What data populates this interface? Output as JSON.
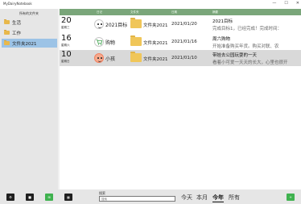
{
  "window": {
    "title": "MyDairyNotebook",
    "controls": [
      "—",
      "☐",
      "✕"
    ]
  },
  "sidebar": {
    "title": "所有的文件夹",
    "items": [
      {
        "label": "生活"
      },
      {
        "label": "工作"
      },
      {
        "label": "文件夹2021",
        "selected": true
      }
    ]
  },
  "table": {
    "headers": {
      "day": "",
      "diary": "日记",
      "folder": "文件夹",
      "date": "日期",
      "content": "摘要"
    },
    "rows": [
      {
        "day": "20",
        "weekday": "星期三",
        "avatar": "smiley-icon",
        "name": "2021目标",
        "folder": "文件夹2021",
        "date": "2021/01/20",
        "title": "2021目标",
        "preview": "完成目标1，已经完成！完成时间："
      },
      {
        "day": "16",
        "weekday": "星期六",
        "avatar": "cart-icon",
        "name": "购物",
        "folder": "文件夹2021",
        "date": "2021/01/16",
        "title": "周六购物",
        "preview": "开始准备购买年货。购买对联、农"
      },
      {
        "day": "10",
        "weekday": "星期日",
        "avatar": "girl-face-icon",
        "name": "小孩",
        "folder": "文件夹2021",
        "date": "2021/01/10",
        "title": "带娃去公园玩耍的一天",
        "preview": "看着小可爱一天天的长大，心里也很开"
      }
    ]
  },
  "bottom": {
    "buttons": [
      {
        "icon": "settings-icon",
        "glyph": "⚙"
      },
      {
        "icon": "new-diary-icon",
        "glyph": "■"
      },
      {
        "icon": "folder-view-icon",
        "glyph": "⊞"
      },
      {
        "icon": "grid-view-icon",
        "glyph": "▦"
      }
    ],
    "search": {
      "label": "搜索",
      "placeholder": "搜索"
    },
    "filters": [
      {
        "label": "今天"
      },
      {
        "label": "本月"
      },
      {
        "label": "今年",
        "active": true
      },
      {
        "label": "所有"
      }
    ],
    "add_button": {
      "icon": "add-icon",
      "glyph": "+"
    }
  }
}
